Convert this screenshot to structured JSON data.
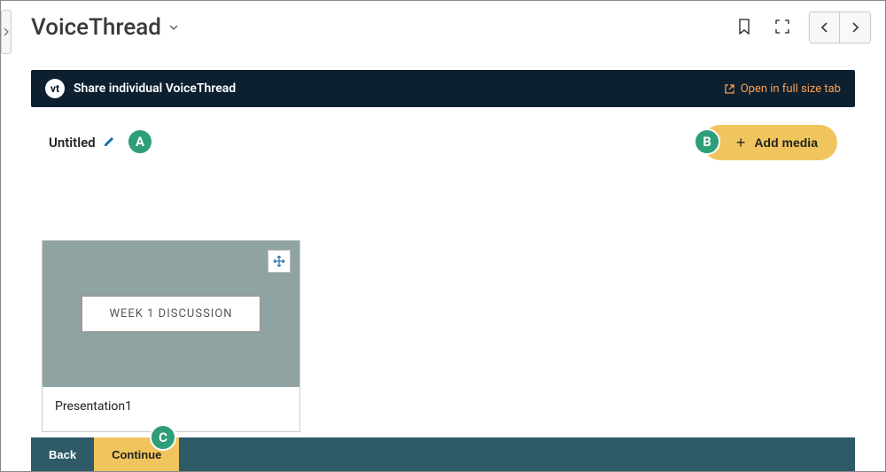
{
  "app_title": "VoiceThread",
  "header": {
    "share_label": "Share individual VoiceThread",
    "vt_badge": "vt",
    "open_link": "Open in full size tab"
  },
  "document": {
    "title": "Untitled",
    "add_media_label": "Add media"
  },
  "media_card": {
    "thumb_label": "WEEK 1 DISCUSSION",
    "caption": "Presentation1"
  },
  "bottom": {
    "back": "Back",
    "continue": "Continue"
  },
  "markers": {
    "a": "A",
    "b": "B",
    "c": "C"
  }
}
